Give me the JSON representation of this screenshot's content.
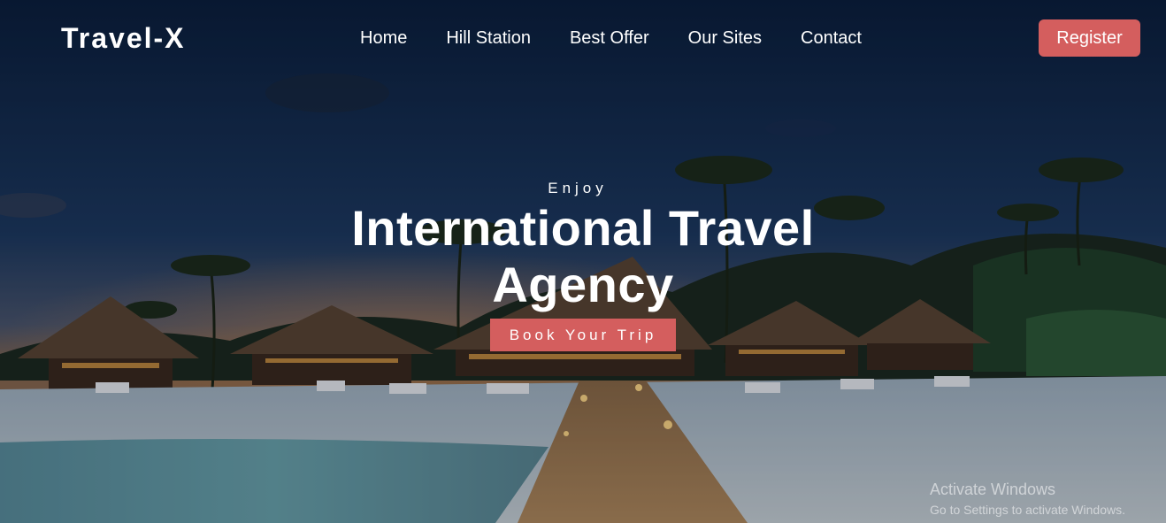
{
  "nav": {
    "logo": "Travel-X",
    "items": [
      {
        "label": "Home"
      },
      {
        "label": "Hill Station"
      },
      {
        "label": "Best Offer"
      },
      {
        "label": "Our Sites"
      },
      {
        "label": "Contact"
      }
    ],
    "register_label": "Register"
  },
  "hero": {
    "eyebrow": "Enjoy",
    "title": "International Travel Agency",
    "cta_label": "Book Your Trip"
  },
  "watermark": {
    "line1": "Activate Windows",
    "line2": "Go to Settings to activate Windows."
  },
  "colors": {
    "accent": "#d45e5e",
    "text": "#ffffff"
  }
}
